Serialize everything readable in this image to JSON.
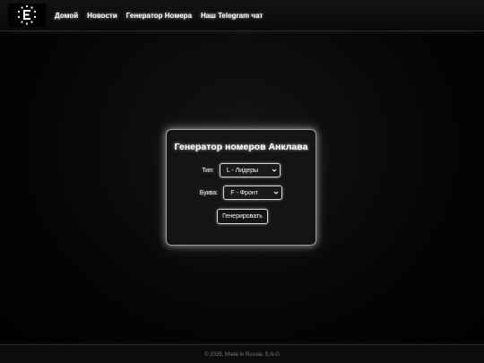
{
  "header": {
    "logo_icon": "enclave-e-stars-icon",
    "nav": [
      {
        "label": "Домой"
      },
      {
        "label": "Новости"
      },
      {
        "label": "Генератор Номера"
      },
      {
        "label": "Наш Telegram чат"
      }
    ]
  },
  "generator": {
    "title": "Генератор номеров Анклава",
    "type_label": "Тип:",
    "type_value": "L - Лидеры",
    "letter_label": "Буква:",
    "letter_value": "F - Фронт",
    "generate_label": "Генерировать"
  },
  "footer": {
    "text": "© 2025, Made in Russia, S.N.G"
  },
  "colors": {
    "background": "#000000",
    "text": "#ffffff",
    "glow": "#ffffff",
    "footer_text": "#7a7a7a"
  }
}
